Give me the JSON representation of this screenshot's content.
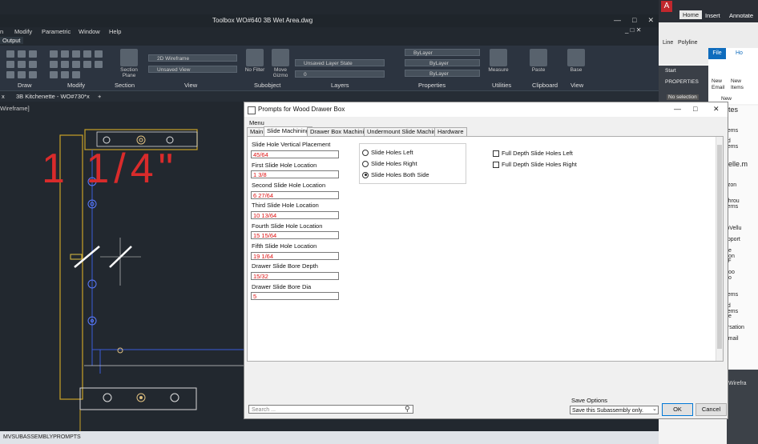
{
  "cad": {
    "title": "Toolbox    WO#640 3B Wet Area.dwg",
    "menu": [
      "n",
      "Modify",
      "Parametric",
      "Window",
      "Help"
    ],
    "output_tab": "Output",
    "ribbon": {
      "panels": [
        "Draw",
        "Modify",
        "Section",
        "View",
        "Subobject",
        "Layers",
        "Properties",
        "Utilities",
        "Clipboard",
        "View"
      ],
      "section_plane": "Section Plane",
      "visual_style": "2D Wireframe",
      "view_state": "Unsaved View",
      "no_filter": "No Filter",
      "move_gizmo": "Move Gizmo",
      "layer_state": "Unsaved Layer State",
      "layer_value": "0",
      "bylayer_color": "ByLayer",
      "bylayer_line": "ByLayer",
      "bylayer_weight": "ByLayer",
      "measure": "Measure",
      "paste": "Paste",
      "base": "Base"
    },
    "doc_tabs": [
      "3B Kitchenette - WO#730*"
    ],
    "viewport_label": "Wireframe]",
    "annotation": "1 1/4\"",
    "command_line": "MVSUBASSEMBLYPROMPTS"
  },
  "right_app": {
    "tabs": [
      "Home",
      "Insert",
      "Annotate"
    ],
    "tools": [
      "Line",
      "Polyline"
    ],
    "file_tab": "File",
    "home_tab": "Ho",
    "new_email": "New Email",
    "new_items": "New Items",
    "new_label": "New",
    "properties": "PROPERTIES",
    "start": "Start",
    "no_selection": "No selection",
    "fav_title": "rites",
    "list": [
      "Items",
      "ed Items",
      "helle.m",
      "x",
      "azon",
      "e Shrou",
      "cerns",
      "T",
      "roVellu",
      "upport T",
      "ice Non",
      "TF",
      "Doo Co",
      "s",
      "Items",
      "ed Items",
      "ive",
      "ersation",
      "Email"
    ],
    "wirefra": "Wirefra"
  },
  "dialog": {
    "title": "Prompts for Wood Drawer Box",
    "menu_label": "Menu",
    "tabs": [
      "Main",
      "Slide Machining",
      "Drawer Box Machining",
      "Undermount Slide Machining",
      "Hardware"
    ],
    "fields": [
      {
        "label": "Slide Hole Vertical Placement",
        "value": "45/64"
      },
      {
        "label": "First Slide Hole Location",
        "value": "1 3/8"
      },
      {
        "label": "Second Slide Hole Location",
        "value": "6 27/64"
      },
      {
        "label": "Third Slide Hole Location",
        "value": "10 13/64"
      },
      {
        "label": "Fourth Slide Hole Location",
        "value": "15 15/64"
      },
      {
        "label": "Fifth Slide Hole Location",
        "value": "19 1/64"
      },
      {
        "label": "Drawer Slide Bore Depth",
        "value": "15/32"
      },
      {
        "label": "Drawer Slide Bore Dia",
        "value": "5"
      }
    ],
    "radios": [
      "Slide Holes Left",
      "Slide Holes Right",
      "Slide Holes Both Side"
    ],
    "radio_selected": 2,
    "checkboxes": [
      "Full Depth Slide Holes Left",
      "Full Depth Slide Holes Right"
    ],
    "search_placeholder": "Search ...",
    "save_options_label": "Save Options",
    "save_option_value": "Save this Subassembly only.",
    "ok": "OK",
    "cancel": "Cancel"
  },
  "colors": {
    "cad_bg": "#22282f",
    "accent_blue": "#0078d7",
    "annotation_red": "#d92b2b",
    "field_red": "#dd1111"
  }
}
